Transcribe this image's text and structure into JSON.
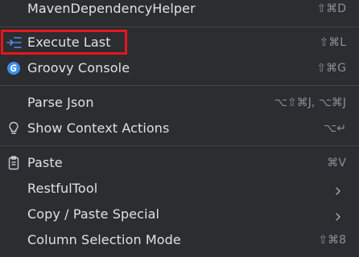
{
  "menu": {
    "items": [
      {
        "label": "MavenDependencyHelper",
        "shortcut": "⇧⌘D"
      },
      {
        "label": "Execute Last",
        "shortcut": "⇧⌘L",
        "icon": "execute-last-icon"
      },
      {
        "label": "Groovy Console",
        "shortcut": "⇧⌘G",
        "icon": "groovy-icon"
      },
      {
        "label": "Parse Json",
        "shortcut": "⌥⇧⌘J, ⌥⌘J"
      },
      {
        "label": "Show Context Actions",
        "shortcut": "⌥↵",
        "icon": "lightbulb-icon"
      },
      {
        "label": "Paste",
        "shortcut": "⌘V",
        "icon": "clipboard-icon"
      },
      {
        "label": "RestfulTool",
        "submenu": true
      },
      {
        "label": "Copy / Paste Special",
        "submenu": true
      },
      {
        "label": "Column Selection Mode",
        "shortcut": "⇧⌘8"
      }
    ]
  },
  "colors": {
    "background": "#2b2d30",
    "text": "#dfe1e5",
    "shortcut": "#8c8f95",
    "separator": "#43454a",
    "highlight": "#e8151d",
    "execute_icon": "#4d8df5",
    "groovy_icon": "#3d8ef0"
  }
}
